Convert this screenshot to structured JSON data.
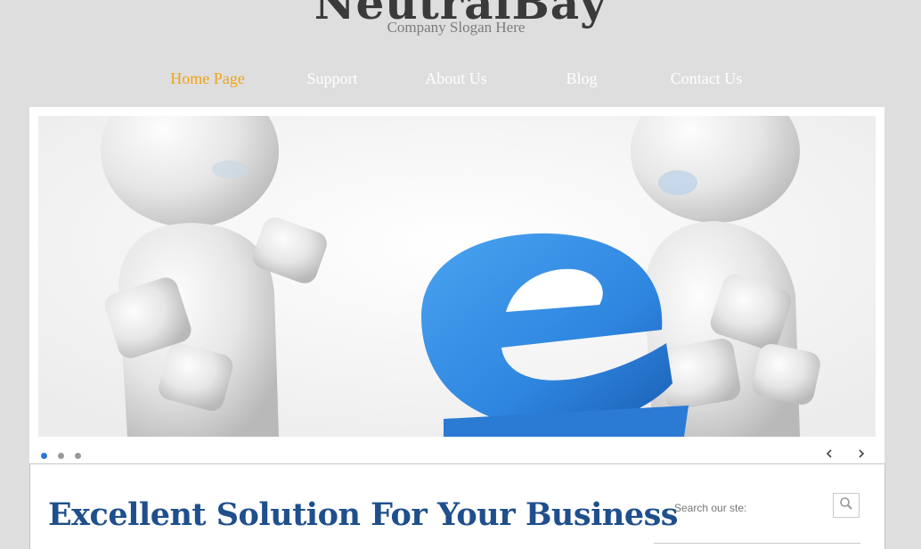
{
  "site": {
    "title": "NeutralBay",
    "slogan": "Company Slogan Here"
  },
  "nav": {
    "items": [
      {
        "label": "Home Page",
        "active": true
      },
      {
        "label": "Support",
        "active": false
      },
      {
        "label": "About Us",
        "active": false
      },
      {
        "label": "Blog",
        "active": false
      },
      {
        "label": "Contact Us",
        "active": false
      }
    ]
  },
  "slider": {
    "slide_count": 3,
    "active_slide": 1,
    "prev_icon": "chevron-left-icon",
    "next_icon": "chevron-right-icon"
  },
  "main": {
    "headline": "Excellent Solution For Your Business"
  },
  "search": {
    "placeholder": "Search our ste:",
    "icon": "search-icon"
  },
  "colors": {
    "background": "#dedede",
    "nav_active": "#f0a416",
    "nav_text": "#ffffff",
    "headline": "#1f4f8c",
    "accent_blue": "#2a78d0"
  }
}
